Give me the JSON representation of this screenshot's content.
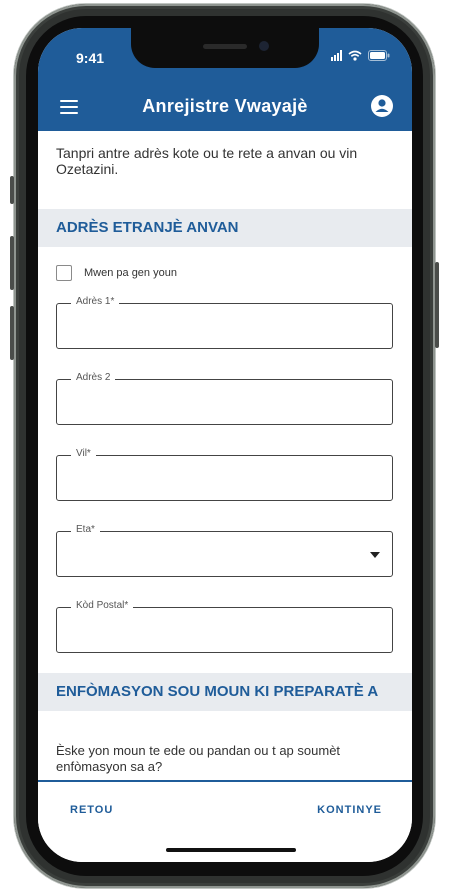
{
  "status_bar": {
    "time": "9:41"
  },
  "app_bar": {
    "title": "Anrejistre Vwayajè",
    "menu_icon": "hamburger-menu-icon",
    "account_icon": "account-circle-icon"
  },
  "intro_text": "Tanpri antre adrès kote ou te rete a anvan ou vin Ozetazini.",
  "section_address": {
    "heading": "ADRÈS ETRANJÈ ANVAN",
    "checkbox_label": "Mwen pa gen youn",
    "fields": {
      "address1": {
        "label": "Adrès 1*",
        "value": ""
      },
      "address2": {
        "label": "Adrès 2",
        "value": ""
      },
      "city": {
        "label": "Vil*",
        "value": ""
      },
      "state": {
        "label": "Eta*",
        "value": ""
      },
      "postal": {
        "label": "Kòd Postal*",
        "value": ""
      }
    }
  },
  "section_preparer": {
    "heading": "ENFÒMASYON SOU MOUN KI PREPARATÈ A",
    "question": "Èske yon moun te ede ou pandan ou t ap soumèt enfòmasyon sa a?"
  },
  "footer": {
    "back_label": "RETOU",
    "next_label": "KONTINYE"
  },
  "colors": {
    "primary": "#1f5c99",
    "section_bg": "#e8ebef"
  }
}
